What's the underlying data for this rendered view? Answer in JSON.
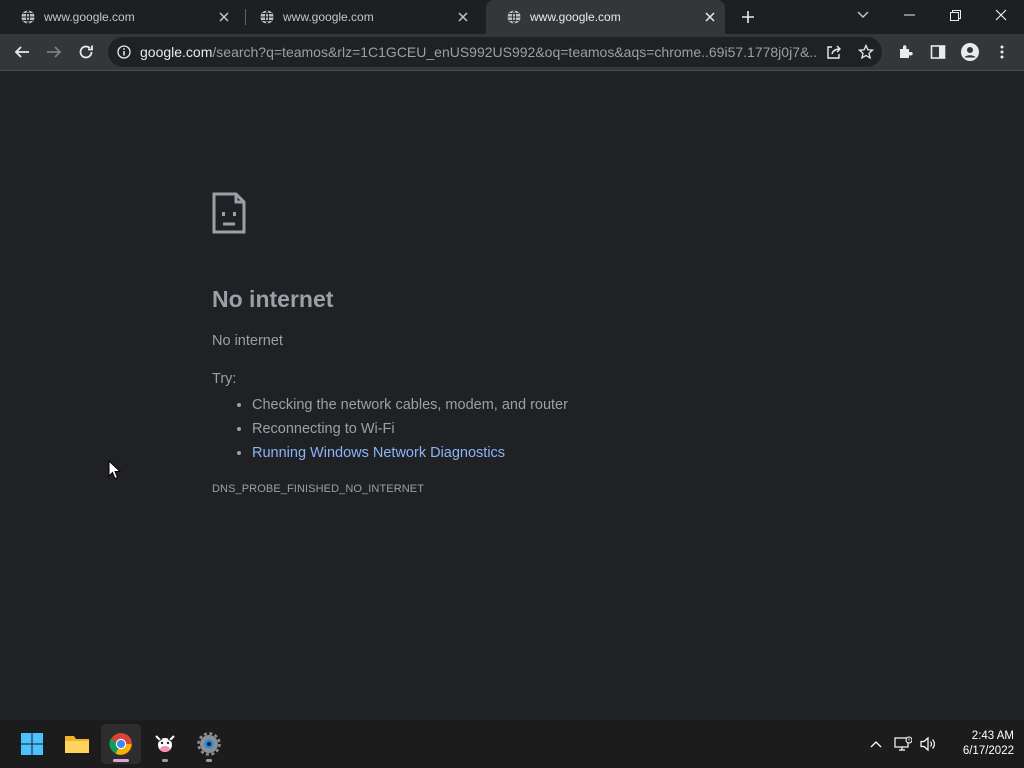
{
  "tabs": [
    {
      "title": "www.google.com",
      "active": false
    },
    {
      "title": "www.google.com",
      "active": false
    },
    {
      "title": "www.google.com",
      "active": true
    }
  ],
  "omnibox": {
    "host": "google.com",
    "path": "/search?q=teamos&rlz=1C1GCEU_enUS992US992&oq=teamos&aqs=chrome..69i57.1778j0j7&..."
  },
  "error_page": {
    "heading": "No internet",
    "subheading": "No internet",
    "try_label": "Try:",
    "suggestions": [
      "Checking the network cables, modem, and router",
      "Reconnecting to Wi-Fi"
    ],
    "diagnostics_link": "Running Windows Network Diagnostics",
    "error_code": "DNS_PROBE_FINISHED_NO_INTERNET"
  },
  "taskbar": {
    "apps": [
      "start-icon",
      "file-explorer-icon",
      "chrome-icon",
      "cow-app-icon",
      "settings-icon"
    ],
    "time": "2:43 AM",
    "date": "6/17/2022"
  },
  "colors": {
    "page_background": "#202124",
    "text": "#9aa0a6",
    "link": "#8ab4f8",
    "toolbar": "#35363a",
    "taskbar": "#1c1c1c"
  }
}
